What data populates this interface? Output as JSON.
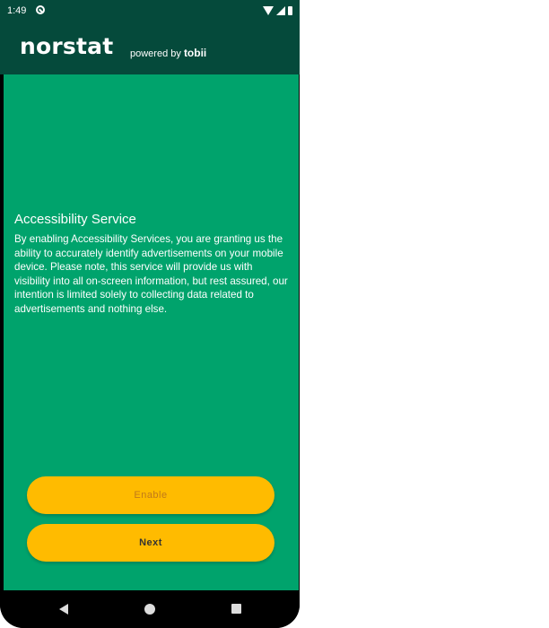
{
  "status_bar": {
    "time": "1:49",
    "icons": [
      "sync-icon",
      "wifi-icon",
      "signal-icon",
      "battery-icon"
    ]
  },
  "header": {
    "brand": "norstat",
    "powered_by": "powered by",
    "partner": "tobii",
    "background_color": "#054a3b"
  },
  "content": {
    "background_color": "#00a36c",
    "title": "Accessibility Service",
    "body": "By enabling Accessibility Services, you are granting us the ability to accurately identify advertisements on your mobile device. Please note, this service will provide us with visibility into all on-screen information, but rest assured, our intention is limited solely to collecting data related to advertisements and nothing else."
  },
  "buttons": {
    "enable_label": "Enable",
    "next_label": "Next",
    "color": "#ffbb00"
  },
  "nav_bar": {
    "icons": [
      "back-icon",
      "home-icon",
      "recents-icon"
    ]
  }
}
